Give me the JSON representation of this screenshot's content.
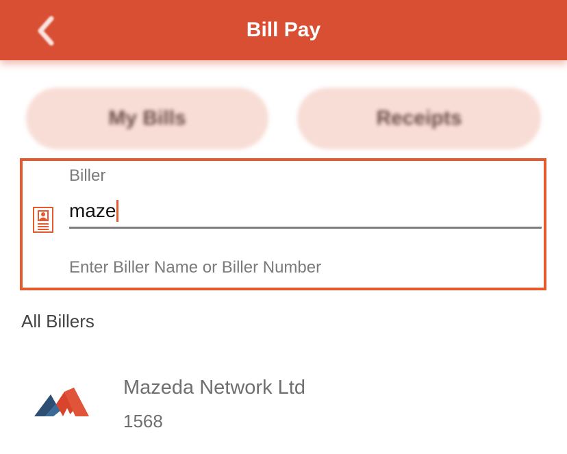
{
  "header": {
    "title": "Bill Pay",
    "back_icon": "chevron-left-icon",
    "background_color": "#d94f33"
  },
  "tabs": [
    {
      "label": "My Bills"
    },
    {
      "label": "Receipts"
    }
  ],
  "biller_field": {
    "label": "Biller",
    "value": "maze",
    "helper_text": "Enter Biller Name or Biller Number",
    "icon": "id-card-icon",
    "highlight_color": "#e5592e"
  },
  "section": {
    "title": "All Billers"
  },
  "billers": [
    {
      "name": "Mazeda Network Ltd",
      "number": "1568",
      "logo": "mazeda-logo"
    }
  ]
}
